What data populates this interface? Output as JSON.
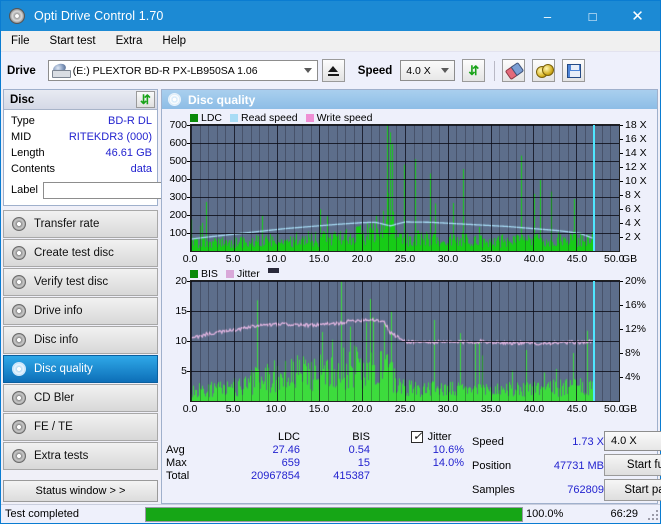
{
  "window": {
    "title": "Opti Drive Control 1.70",
    "icon": "disc-icon",
    "minimize": "–",
    "maximize": "□",
    "close": "✕"
  },
  "menu": [
    "File",
    "Start test",
    "Extra",
    "Help"
  ],
  "toolbar": {
    "drive_label": "Drive",
    "drive_value": "(E:)  PLEXTOR BD-R  PX-LB950SA 1.06",
    "eject_name": "eject-button",
    "speed_label": "Speed",
    "speed_value": "4.0 X",
    "icons": [
      "refresh-icon",
      "eraser-icon",
      "gold-disc-icon",
      "save-icon"
    ]
  },
  "disc": {
    "header": "Disc",
    "refresh_icon": "refresh-icon",
    "rows": [
      {
        "key": "Type",
        "value": "BD-R DL"
      },
      {
        "key": "MID",
        "value": "RITEKDR3 (000)"
      },
      {
        "key": "Length",
        "value": "46.61 GB"
      },
      {
        "key": "Contents",
        "value": "data"
      }
    ],
    "label_key": "Label",
    "label_value": "",
    "label_placeholder": ""
  },
  "sidebar": {
    "items": [
      {
        "label": "Transfer rate",
        "active": false
      },
      {
        "label": "Create test disc",
        "active": false
      },
      {
        "label": "Verify test disc",
        "active": false
      },
      {
        "label": "Drive info",
        "active": false
      },
      {
        "label": "Disc info",
        "active": false
      },
      {
        "label": "Disc quality",
        "active": true
      },
      {
        "label": "CD Bler",
        "active": false
      },
      {
        "label": "FE / TE",
        "active": false
      },
      {
        "label": "Extra tests",
        "active": false
      }
    ],
    "status_button": "Status window > >"
  },
  "panel": {
    "title": "Disc quality",
    "icon": "disc-quality-icon"
  },
  "stats": {
    "col_headers": [
      "LDC",
      "BIS"
    ],
    "jitter_label": "Jitter",
    "jitter_checked": true,
    "rows": [
      {
        "name": "Avg",
        "ldc": "27.46",
        "bis": "0.54",
        "jitter": "10.6%"
      },
      {
        "name": "Max",
        "ldc": "659",
        "bis": "15",
        "jitter": "14.0%"
      },
      {
        "name": "Total",
        "ldc": "20967854",
        "bis": "415387",
        "jitter": ""
      }
    ],
    "right": [
      {
        "key": "Speed",
        "value": "1.73 X"
      },
      {
        "key": "Position",
        "value": "47731 MB"
      },
      {
        "key": "Samples",
        "value": "762809"
      }
    ],
    "speed_select": "4.0 X",
    "start_full": "Start full",
    "start_part": "Start part"
  },
  "statusbar": {
    "text": "Test completed",
    "progress_pct": "100.0%",
    "progress_value": 100,
    "elapsed": "66:29"
  },
  "colors": {
    "accent": "#1c8ad4",
    "plot_bg": "#5d6e8b",
    "ldc_green": "#17cc17",
    "bis_green": "#2db82d",
    "read_speed": "#a8dcf5",
    "write_speed": "#ef8fd4",
    "jitter_pink": "#e0b4e0",
    "value_blue": "#2323cf",
    "progress_green": "#16a616",
    "cursor_cyan": "#4fe6ff"
  },
  "chart_data": [
    {
      "type": "area",
      "name": "top-chart",
      "title": "",
      "xlabel": "GB",
      "ylabel": "",
      "legend": [
        {
          "label": "LDC",
          "color": "#0a8a0a"
        },
        {
          "label": "Read speed",
          "color": "#a8dcf5"
        },
        {
          "label": "Write speed",
          "color": "#ef8fd4"
        }
      ],
      "legend_position": "top-left",
      "grid": true,
      "xlim": [
        0,
        50
      ],
      "xticks": [
        0.0,
        5.0,
        10.0,
        15.0,
        20.0,
        25.0,
        30.0,
        35.0,
        40.0,
        45.0,
        50.0
      ],
      "xticklabels": [
        "0.0",
        "5.0",
        "10.0",
        "15.0",
        "20.0",
        "25.0",
        "30.0",
        "35.0",
        "40.0",
        "45.0",
        "50.0"
      ],
      "x_unit": "GB",
      "ylim": [
        0,
        700
      ],
      "yticks": [
        100,
        200,
        300,
        400,
        500,
        600,
        700
      ],
      "yticklabels": [
        "100",
        "200",
        "300",
        "400",
        "500",
        "600",
        "700"
      ],
      "y2lim": [
        0,
        18
      ],
      "y2ticks": [
        2,
        4,
        6,
        8,
        10,
        12,
        14,
        16,
        18
      ],
      "y2ticklabels": [
        "2 X",
        "4 X",
        "6 X",
        "8 X",
        "10 X",
        "12 X",
        "14 X",
        "16 X",
        "18 X"
      ],
      "data_end_x": 47.0,
      "series": [
        {
          "name": "LDC",
          "color": "#17cc17",
          "kind": "spikes",
          "baseline_x": [
            0,
            3,
            6,
            9,
            12,
            15,
            18,
            20,
            21,
            22,
            23,
            24,
            25,
            27,
            30,
            33,
            36,
            39,
            42,
            45,
            47
          ],
          "baseline_y": [
            40,
            42,
            45,
            50,
            55,
            62,
            70,
            80,
            95,
            120,
            180,
            90,
            70,
            62,
            58,
            55,
            52,
            50,
            55,
            60,
            62
          ],
          "peak_x": [
            23.2,
            23.5,
            24.9,
            26.2,
            27.9,
            31.8,
            38.5,
            40.8
          ],
          "peak_y": [
            659,
            600,
            480,
            510,
            430,
            455,
            530,
            395
          ]
        },
        {
          "name": "Read speed",
          "color": "#a8dcf5",
          "kind": "line",
          "x": [
            0,
            2,
            5,
            8,
            11,
            14,
            17,
            20,
            21.5,
            23.3,
            25,
            28,
            31,
            34,
            37,
            40,
            43,
            45.5,
            47
          ],
          "y_right_x": [
            1.7,
            2.0,
            2.4,
            2.8,
            3.2,
            3.5,
            3.8,
            4.05,
            4.1,
            3.6,
            4.15,
            4.1,
            3.9,
            3.7,
            3.5,
            3.2,
            2.9,
            2.5,
            1.8
          ]
        },
        {
          "name": "Write speed",
          "color": "#ef8fd4",
          "kind": "none",
          "x": [],
          "y": []
        }
      ]
    },
    {
      "type": "area",
      "name": "bottom-chart",
      "title": "",
      "xlabel": "GB",
      "ylabel": "",
      "legend": [
        {
          "label": "BIS",
          "color": "#0a8a0a"
        },
        {
          "label": "Jitter",
          "color": "#d9a8d9"
        }
      ],
      "legend_position": "top-left",
      "grid": true,
      "xlim": [
        0,
        50
      ],
      "xticks": [
        0.0,
        5.0,
        10.0,
        15.0,
        20.0,
        25.0,
        30.0,
        35.0,
        40.0,
        45.0,
        50.0
      ],
      "xticklabels": [
        "0.0",
        "5.0",
        "10.0",
        "15.0",
        "20.0",
        "25.0",
        "30.0",
        "35.0",
        "40.0",
        "45.0",
        "50.0"
      ],
      "x_unit": "GB",
      "ylim": [
        0,
        20
      ],
      "yticks": [
        5,
        10,
        15,
        20
      ],
      "yticklabels": [
        "5",
        "10",
        "15",
        "20"
      ],
      "y2lim": [
        0,
        20
      ],
      "y2ticks": [
        4,
        8,
        12,
        16,
        20
      ],
      "y2ticklabels": [
        "4%",
        "8%",
        "12%",
        "16%",
        "20%"
      ],
      "data_end_x": 47.0,
      "series": [
        {
          "name": "BIS",
          "color": "#3ddc3d",
          "kind": "spikes",
          "baseline_x": [
            0,
            3,
            6,
            8,
            10,
            13,
            16,
            19,
            21,
            23,
            24,
            26,
            29,
            32,
            35,
            38,
            41,
            44,
            47
          ],
          "baseline_y": [
            1.6,
            1.8,
            2.2,
            3.4,
            3.8,
            4.2,
            4.6,
            5.2,
            5.4,
            5.0,
            2.4,
            1.9,
            1.8,
            1.7,
            1.7,
            1.8,
            1.9,
            2.0,
            2.1
          ],
          "peak_x": [
            15.3,
            16.5,
            18.6,
            20.4,
            21.3,
            22.6,
            23.4,
            28.4,
            33.2,
            39.1,
            44.6
          ],
          "peak_y": [
            11.5,
            10.2,
            12.4,
            13.1,
            14.0,
            13.0,
            15.0,
            13.5,
            9.6,
            8.5,
            8.0
          ]
        },
        {
          "name": "Jitter",
          "color": "#e0b4e0",
          "kind": "line",
          "x": [
            0,
            2,
            5,
            8,
            11,
            14,
            17,
            19,
            21,
            22.5,
            23.3,
            25,
            28,
            31,
            34,
            37,
            40,
            43,
            45.5,
            47
          ],
          "y_pct": [
            10.4,
            11.2,
            11.8,
            12.6,
            12.8,
            12.6,
            12.9,
            13.4,
            13.6,
            13.3,
            11.4,
            9.9,
            9.8,
            9.8,
            9.9,
            9.7,
            9.6,
            9.7,
            9.8,
            9.9
          ]
        }
      ]
    }
  ]
}
